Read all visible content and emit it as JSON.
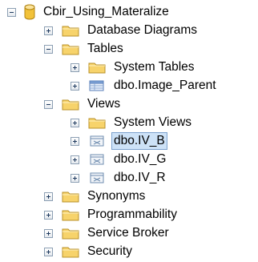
{
  "object_explorer": {
    "database": {
      "label": "Cbir_Using_Materalize",
      "expanded": true,
      "icon": "database-icon"
    },
    "items": [
      {
        "label": "Database Diagrams",
        "icon": "folder-icon",
        "toggle": "plus"
      },
      {
        "label": "Tables",
        "icon": "folder-icon",
        "toggle": "minus"
      },
      {
        "label": "System Tables",
        "icon": "folder-icon",
        "toggle": "plus"
      },
      {
        "label": "dbo.Image_Parent",
        "icon": "table-icon",
        "toggle": "plus"
      },
      {
        "label": "Views",
        "icon": "folder-icon",
        "toggle": "minus"
      },
      {
        "label": "System Views",
        "icon": "folder-icon",
        "toggle": "plus"
      },
      {
        "label": "dbo.IV_B",
        "icon": "view-icon",
        "toggle": "plus",
        "selected": true
      },
      {
        "label": "dbo.IV_G",
        "icon": "view-icon",
        "toggle": "plus"
      },
      {
        "label": "dbo.IV_R",
        "icon": "view-icon",
        "toggle": "plus"
      },
      {
        "label": "Synonyms",
        "icon": "folder-icon",
        "toggle": "plus"
      },
      {
        "label": "Programmability",
        "icon": "folder-icon",
        "toggle": "plus"
      },
      {
        "label": "Service Broker",
        "icon": "folder-icon",
        "toggle": "plus"
      },
      {
        "label": "Security",
        "icon": "folder-icon",
        "toggle": "plus"
      }
    ]
  },
  "colors": {
    "selection_background": "#cde2f7",
    "selection_border": "#7da2ce",
    "folder_fill": "#f7d36b",
    "database_fill": "#f2c23a"
  }
}
